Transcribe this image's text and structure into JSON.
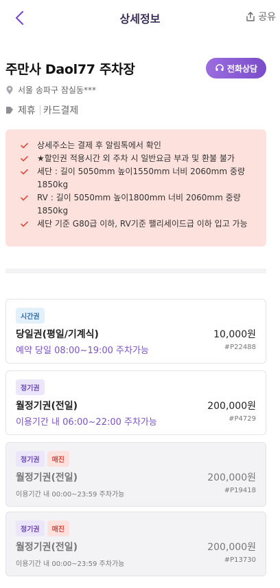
{
  "header": {
    "title": "상세정보",
    "share_label": "공유"
  },
  "lot": {
    "name": "주만사 Daol77 주차장",
    "call_label": "전화상담",
    "address": "서울 송파구 잠실동***",
    "tags": [
      "제휴",
      "카드결제"
    ]
  },
  "notices": [
    "상세주소는 결제 후 알림톡에서 확인",
    "★할인권 적용시간 외 주차 시 일반요금 부과 및 환불 불가",
    "세단 : 길이 5050mm 높이1550mm 너비 2060mm 중량 1850kg",
    "RV : 길이 5050mm 높이1800mm 너비 2060mm 중량 1850kg",
    "세단 기준 G80급 이하, RV기준 팰리세이드급 이하 입고 가능"
  ],
  "tickets": [
    {
      "badge": "시간권",
      "sold_label": "",
      "name": "당일권(평일/기계식)",
      "desc": "예약 당일 08:00~19:00 주차가능",
      "price": "10,000원",
      "code": "#P22488"
    },
    {
      "badge": "정기권",
      "sold_label": "",
      "name": "월정기권(전일)",
      "desc": "이용기간 내 06:00~22:00 주차가능",
      "price": "200,000원",
      "code": "#P4729"
    },
    {
      "badge": "정기권",
      "sold_label": "매진",
      "name": "월정기권(전일)",
      "desc": "이용기간 내 00:00~23:59 주차가능",
      "price": "200,000원",
      "code": "#P19418"
    },
    {
      "badge": "정기권",
      "sold_label": "매진",
      "name": "월정기권(전일)",
      "desc": "이용기간 내 00:00~23:59 주차가능",
      "price": "200,000원",
      "code": "#P13730"
    }
  ],
  "colors": {
    "accent": "#7a4cc9",
    "notice_bg": "#fde1dd",
    "check": "#e04b3c"
  }
}
